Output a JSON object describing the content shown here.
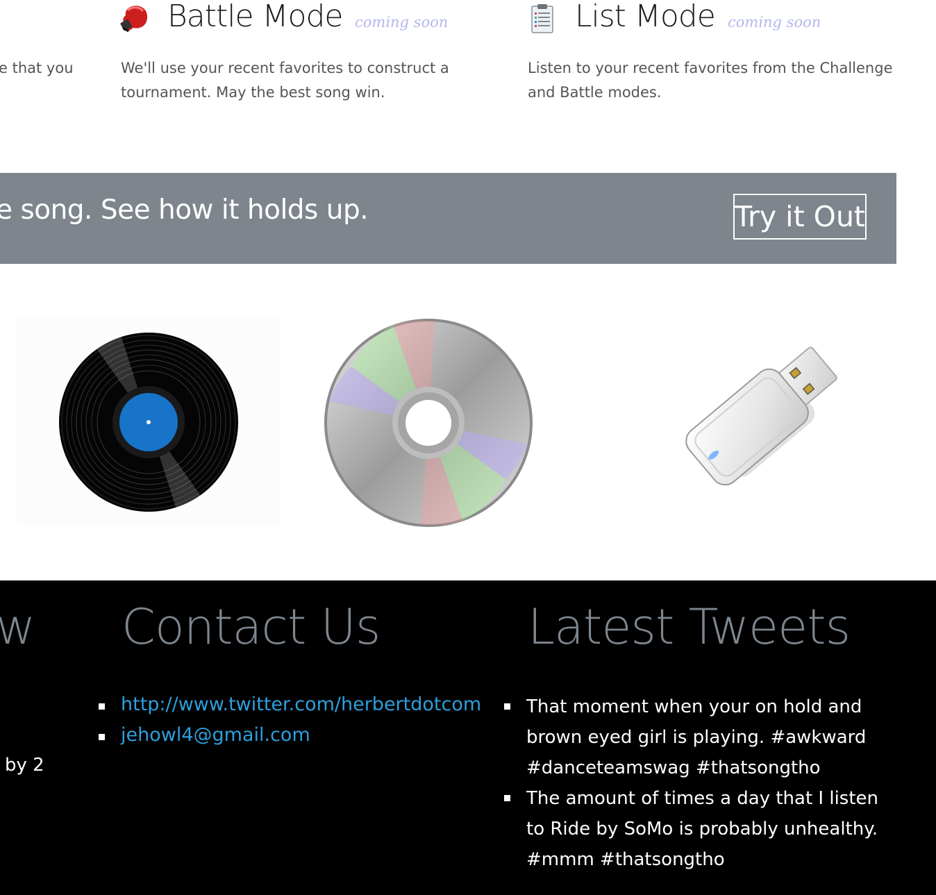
{
  "features": [
    {
      "id": "challenge",
      "desc_fragment": "e that you"
    },
    {
      "id": "battle",
      "title": "Battle Mode",
      "badge": "coming soon",
      "icon": "boxing-glove-icon",
      "desc": "We'll use your recent favorites to construct a tournament. May the best song win."
    },
    {
      "id": "list",
      "title": "List Mode",
      "badge": "coming soon",
      "icon": "clipboard-icon",
      "desc": "Listen to your recent favorites from the Challenge and Battle modes."
    }
  ],
  "banner": {
    "text": "e song. See how it holds up.",
    "button": "Try it Out",
    "background": "#7e858c"
  },
  "media_images": [
    "vinyl-record",
    "compact-disc",
    "usb-flash-drive"
  ],
  "footer": {
    "left_heading_fragment": "w",
    "left_text_fragment": "by 2",
    "contact": {
      "heading": "Contact Us",
      "links": [
        "http://www.twitter.com/herbertdotcom",
        "jehowl4@gmail.com"
      ]
    },
    "tweets": {
      "heading": "Latest Tweets",
      "items": [
        "That moment when your on hold and brown eyed girl is playing. #awkward #danceteamswag #thatsongtho",
        "The amount of times a day that I listen to Ride by SoMo is probably unhealthy. #mmm #thatsongtho"
      ]
    }
  },
  "colors": {
    "link": "#2e9fdc",
    "heading_gray": "#7e8790",
    "coming_soon": "#b3b6ee"
  }
}
